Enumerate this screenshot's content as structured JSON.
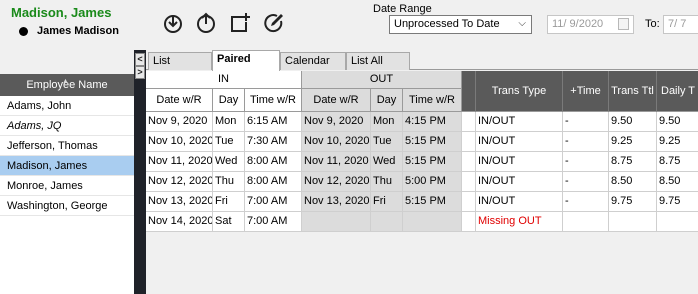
{
  "header": {
    "employee_title": "Madison, James",
    "employee_name": "James Madison",
    "title_color": "#1a8a1a",
    "toolbar_icons": [
      "clock-in-icon",
      "clock-out-icon",
      "add-entry-icon",
      "edit-icon"
    ]
  },
  "date_range": {
    "label": "Date Range",
    "selected": "Unprocessed To Date",
    "from_value": "11/  9/2020",
    "to_label": "To:",
    "to_value": "7/  7"
  },
  "left_panel": {
    "column_header": "Employee Name",
    "employees": [
      {
        "name": "Adams, John",
        "italic": false,
        "selected": false
      },
      {
        "name": "Adams, JQ",
        "italic": true,
        "selected": false
      },
      {
        "name": "Jefferson, Thomas",
        "italic": false,
        "selected": false
      },
      {
        "name": "Madison, James",
        "italic": false,
        "selected": true
      },
      {
        "name": "Monroe, James",
        "italic": false,
        "selected": false
      },
      {
        "name": "Washington, George",
        "italic": false,
        "selected": false
      }
    ],
    "selected_color": "#a9cdf0"
  },
  "tabs": [
    "List",
    "Paired",
    "Calendar",
    "List All"
  ],
  "active_tab": "Paired",
  "grid": {
    "group_in": "IN",
    "group_out": "OUT",
    "columns": {
      "in_date": "Date w/R",
      "in_day": "Day",
      "in_time": "Time w/R",
      "out_date": "Date w/R",
      "out_day": "Day",
      "out_time": "Time w/R",
      "trans_type": "Trans Type",
      "plus_time": "+Time",
      "trans_ttl": "Trans Ttl",
      "daily_t": "Daily T"
    },
    "rows": [
      {
        "in_date": "Nov 9, 2020",
        "in_day": "Mon",
        "in_time": "6:15 AM",
        "out_date": "Nov 9, 2020",
        "out_day": "Mon",
        "out_time": "4:15 PM",
        "trans_type": "IN/OUT",
        "plus_time": "-",
        "trans_ttl": "9.50",
        "daily_t": "9.50",
        "missing": false
      },
      {
        "in_date": "Nov 10, 2020",
        "in_day": "Tue",
        "in_time": "7:30 AM",
        "out_date": "Nov 10, 2020",
        "out_day": "Tue",
        "out_time": "5:15 PM",
        "trans_type": "IN/OUT",
        "plus_time": "-",
        "trans_ttl": "9.25",
        "daily_t": "9.25",
        "missing": false
      },
      {
        "in_date": "Nov 11, 2020",
        "in_day": "Wed",
        "in_time": "8:00 AM",
        "out_date": "Nov 11, 2020",
        "out_day": "Wed",
        "out_time": "5:15 PM",
        "trans_type": "IN/OUT",
        "plus_time": "-",
        "trans_ttl": "8.75",
        "daily_t": "8.75",
        "missing": false
      },
      {
        "in_date": "Nov 12, 2020",
        "in_day": "Thu",
        "in_time": "8:00 AM",
        "out_date": "Nov 12, 2020",
        "out_day": "Thu",
        "out_time": "5:00 PM",
        "trans_type": "IN/OUT",
        "plus_time": "-",
        "trans_ttl": "8.50",
        "daily_t": "8.50",
        "missing": false
      },
      {
        "in_date": "Nov 13, 2020",
        "in_day": "Fri",
        "in_time": "7:00 AM",
        "out_date": "Nov 13, 2020",
        "out_day": "Fri",
        "out_time": "5:15 PM",
        "trans_type": "IN/OUT",
        "plus_time": "-",
        "trans_ttl": "9.75",
        "daily_t": "9.75",
        "missing": false
      },
      {
        "in_date": "Nov 14, 2020",
        "in_day": "Sat",
        "in_time": "7:00 AM",
        "out_date": "",
        "out_day": "",
        "out_time": "",
        "trans_type": "Missing OUT",
        "plus_time": "",
        "trans_ttl": "",
        "daily_t": "",
        "missing": true
      }
    ],
    "missing_color": "#e00000"
  }
}
